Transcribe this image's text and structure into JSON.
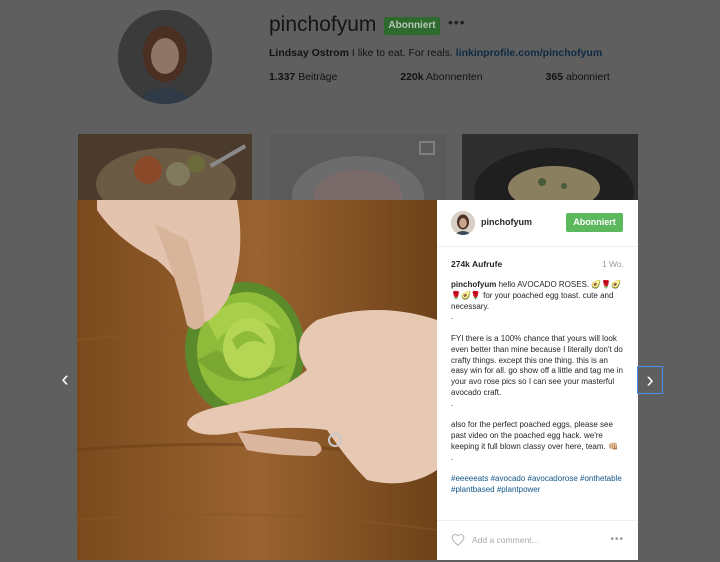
{
  "profile": {
    "username": "pinchofyum",
    "follow_label": "Abonniert",
    "more_icon": "more-horizontal-icon",
    "bio_name": "Lindsay Ostrom",
    "bio_text": " I like to eat. For reals. ",
    "bio_link": "linkinprofile.com/pinchofyum",
    "stats": {
      "posts_value": "1.337",
      "posts_label": " Beiträge",
      "followers_value": "220k",
      "followers_label": " Abonnenten",
      "following_value": "365",
      "following_label": " abonniert"
    }
  },
  "post": {
    "username": "pinchofyum",
    "follow_label": "Abonniert",
    "views": "274k Aufrufe",
    "time": "1 Wo.",
    "caption": {
      "username": "pinchofyum",
      "p1": " hello AVOCADO ROSES. 🥑🌹🥑🌹🥑🌹 for your poached egg toast. cute and necessary.",
      "dot1": ".",
      "p2": "FYI there is a 100% chance that yours will look even better than mine because I literally don't do crafty things. except this one thing. this is an easy win for all. go show off a little and tag me in your avo rose pics so I can see your masterful avocado craft.",
      "dot2": ".",
      "p3": "also for the perfect poached eggs, please see past video on the poached egg hack. we're keeping it full blown classy over here, team. 👊🏼",
      "dot3": ".",
      "tags": "#eeeeeats #avocado #avocadorose #onthetable #plantbased #plantpower"
    },
    "comment_placeholder": "Add a comment...",
    "heart_icon": "heart-icon",
    "options_icon": "more-horizontal-icon"
  },
  "nav": {
    "prev_icon": "chevron-left-icon",
    "next_icon": "chevron-right-icon",
    "prev_glyph": "‹",
    "next_glyph": "›"
  }
}
